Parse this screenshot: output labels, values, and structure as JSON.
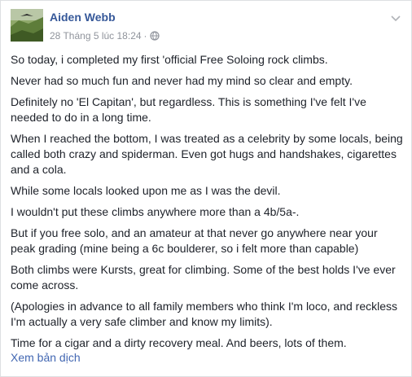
{
  "post": {
    "author": "Aiden Webb",
    "timestamp": "28 Tháng 5 lúc 18:24",
    "separator": "·",
    "privacy_icon": "globe-icon",
    "menu_icon": "chevron-down-icon",
    "paragraphs": [
      "So today, i completed my first 'official Free Soloing rock climbs.",
      "Never had so much fun and never had my mind so clear and empty.",
      "Definitely no 'El Capitan', but regardless. This is something I've felt I've needed to do in a long time.",
      "When I reached the bottom, I was treated as a celebrity by some locals, being called both crazy and spiderman. Even got hugs and handshakes, cigarettes and a cola.",
      "While some locals looked upon me as I was the devil.",
      "I wouldn't put these climbs anywhere more than a 4b/5a-.",
      "But if you free solo, and an amateur at that never go anywhere near your peak grading (mine being a 6c boulderer, so i felt more than capable)",
      "Both climbs were Kursts, great for climbing. Some of the best holds I've ever come across.",
      "(Apologies in advance to all family members who think I'm loco, and reckless I'm actually a very safe climber and know my limits).",
      "Time for a cigar and a dirty recovery meal. And beers, lots of them."
    ],
    "translate_link": "Xem bản dịch"
  },
  "colors": {
    "author_link": "#365899",
    "meta_text": "#90949c",
    "body_text": "#1d2129",
    "link": "#4267b2",
    "card_border": "#dddfe2"
  }
}
